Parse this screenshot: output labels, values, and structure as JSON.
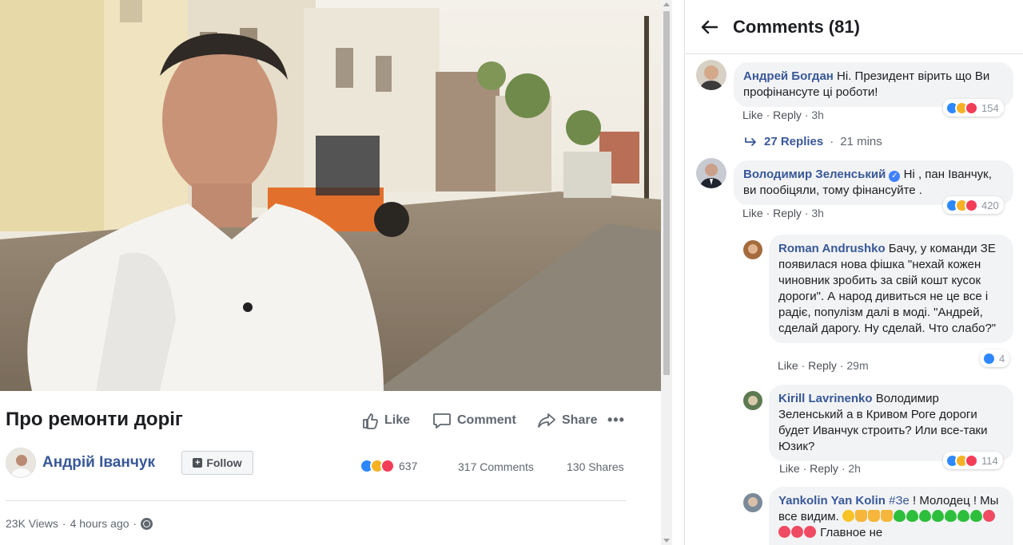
{
  "post": {
    "title": "Про ремонти доріг",
    "author": "Андрій Іванчук",
    "follow_label": "Follow",
    "actions": {
      "like": "Like",
      "comment": "Comment",
      "share": "Share",
      "more": "•••"
    },
    "reaction_count": "637",
    "comments_count": "317 Comments",
    "shares_count": "130 Shares",
    "views": "23K Views",
    "time": "4 hours ago",
    "separator": "·"
  },
  "panel": {
    "title": "Comments (81)",
    "comments": [
      {
        "name": "Андрей Богдан",
        "text": "Ні. Президент вірить що Ви профінансуте ці роботи!",
        "like": "Like",
        "reply": "Reply",
        "time": "3h",
        "reactions": "154",
        "replies_label": "27 Replies",
        "replies_time": "21 mins"
      },
      {
        "name": "Володимир Зеленський",
        "text": "Ні , пан Іванчук, ви пообіцяли, тому фінансуйте .",
        "like": "Like",
        "reply": "Reply",
        "time": "3h",
        "reactions": "420"
      },
      {
        "name": "Roman Andrushko",
        "text": "Бачу, у команди ЗЕ появилася нова фішка \"нехай кожен чиновник зробить за свій кошт кусок дороги\". А народ дивиться не це все і радіє, популізм далі в моді. \"Андрей, сделай дарогу. Ну сделай. Что слабо?\"",
        "like": "Like",
        "reply": "Reply",
        "time": "29m",
        "reactions": "4"
      },
      {
        "name": "Kirill Lavrinenko",
        "text": "Володимир Зеленський а в Кривом Роге дороги будет Иванчук строить? Или все-таки Юзик?",
        "like": "Like",
        "reply": "Reply",
        "time": "2h",
        "reactions": "114"
      },
      {
        "name": "Yankolin Yan Kolin",
        "tag": "#Зе",
        "text_a": "! Молодец ! Мы все видим.",
        "text_b": "Главное не"
      }
    ]
  },
  "colors": {
    "link": "#385898",
    "like_blue": "#2d88ff",
    "haha_yellow": "#f7b125",
    "love_red": "#f33e58"
  },
  "icons": [
    "back-arrow-icon",
    "like-icon",
    "comment-icon",
    "share-icon",
    "globe-icon",
    "verified-icon",
    "follow-icon"
  ]
}
